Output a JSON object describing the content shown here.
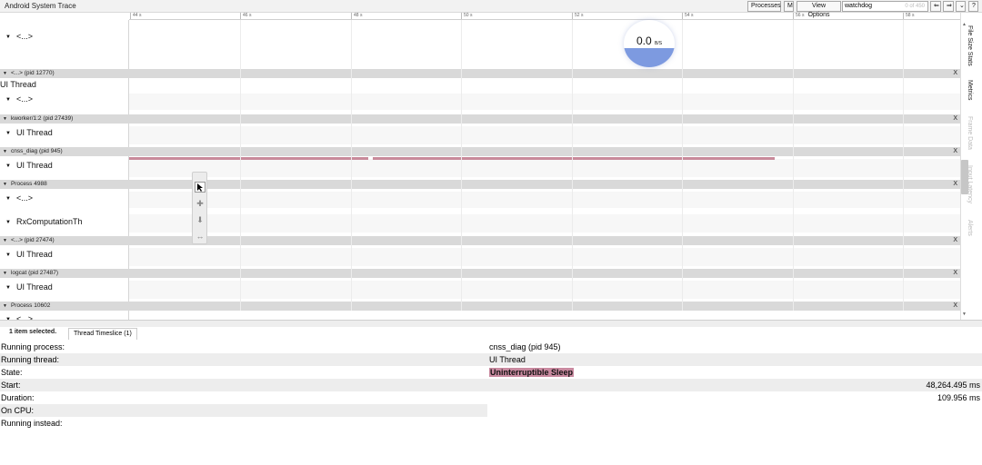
{
  "app": {
    "title": "Android System Trace"
  },
  "toolbar": {
    "processes_label": "Processes",
    "m_label": "M",
    "view_options_label": "View Options",
    "search_value": "watchdog",
    "search_count": "0 of 450",
    "prev_label": "⇐",
    "next_label": "⇒",
    "down_label": "⌄",
    "help_label": "?"
  },
  "ruler": {
    "ticks": [
      "44 s",
      "46 s",
      "48 s",
      "50 s",
      "52 s",
      "54 s",
      "56 s",
      "58 s"
    ]
  },
  "gauge": {
    "value": "0.0",
    "unit": "B/S",
    "fill_fraction": 0.4,
    "color": "#6f8fdd"
  },
  "tracks": {
    "top_label": "<...>",
    "p1": {
      "header": "<...> (pid 12770)",
      "thread": "UI Thread",
      "sub": "<...>"
    },
    "p2": {
      "header": "kworker/1:2 (pid 27439)",
      "thread": "UI Thread"
    },
    "p3": {
      "header": "cnss_diag (pid 945)",
      "thread": "UI Thread"
    },
    "p4": {
      "header": "Process 4988",
      "thread1": "<...>",
      "thread2": "RxComputationTh"
    },
    "p5": {
      "header": "<...> (pid 27474)",
      "thread": "UI Thread"
    },
    "p6": {
      "header": "logcat (pid 27487)",
      "thread": "UI Thread"
    },
    "p7": {
      "header": "Process 10602",
      "thread": "<...>"
    },
    "close_label": "X"
  },
  "sidebar_tabs": [
    "File Size Stats",
    "Metrics",
    "Frame Data",
    "Input Latency",
    "Alerts"
  ],
  "tools": [
    "select-icon",
    "pan-icon",
    "zoom-icon",
    "timing-icon"
  ],
  "details": {
    "selection_label": "1 item selected.",
    "tab_label": "Thread Timeslice (1)",
    "running_process_key": "Running process:",
    "running_process_val": "cnss_diag (pid 945)",
    "running_thread_key": "Running thread:",
    "running_thread_val": "UI Thread",
    "state_key": "State:",
    "state_val": "Uninterruptible Sleep",
    "start_key": "Start:",
    "start_val": "48,264.495 ms",
    "duration_key": "Duration:",
    "duration_val": "109.956 ms",
    "on_cpu_key": "On CPU:",
    "running_instead_key": "Running instead:"
  },
  "colors": {
    "slice": "#c88a9a",
    "header_bg": "#d9d9d9"
  }
}
